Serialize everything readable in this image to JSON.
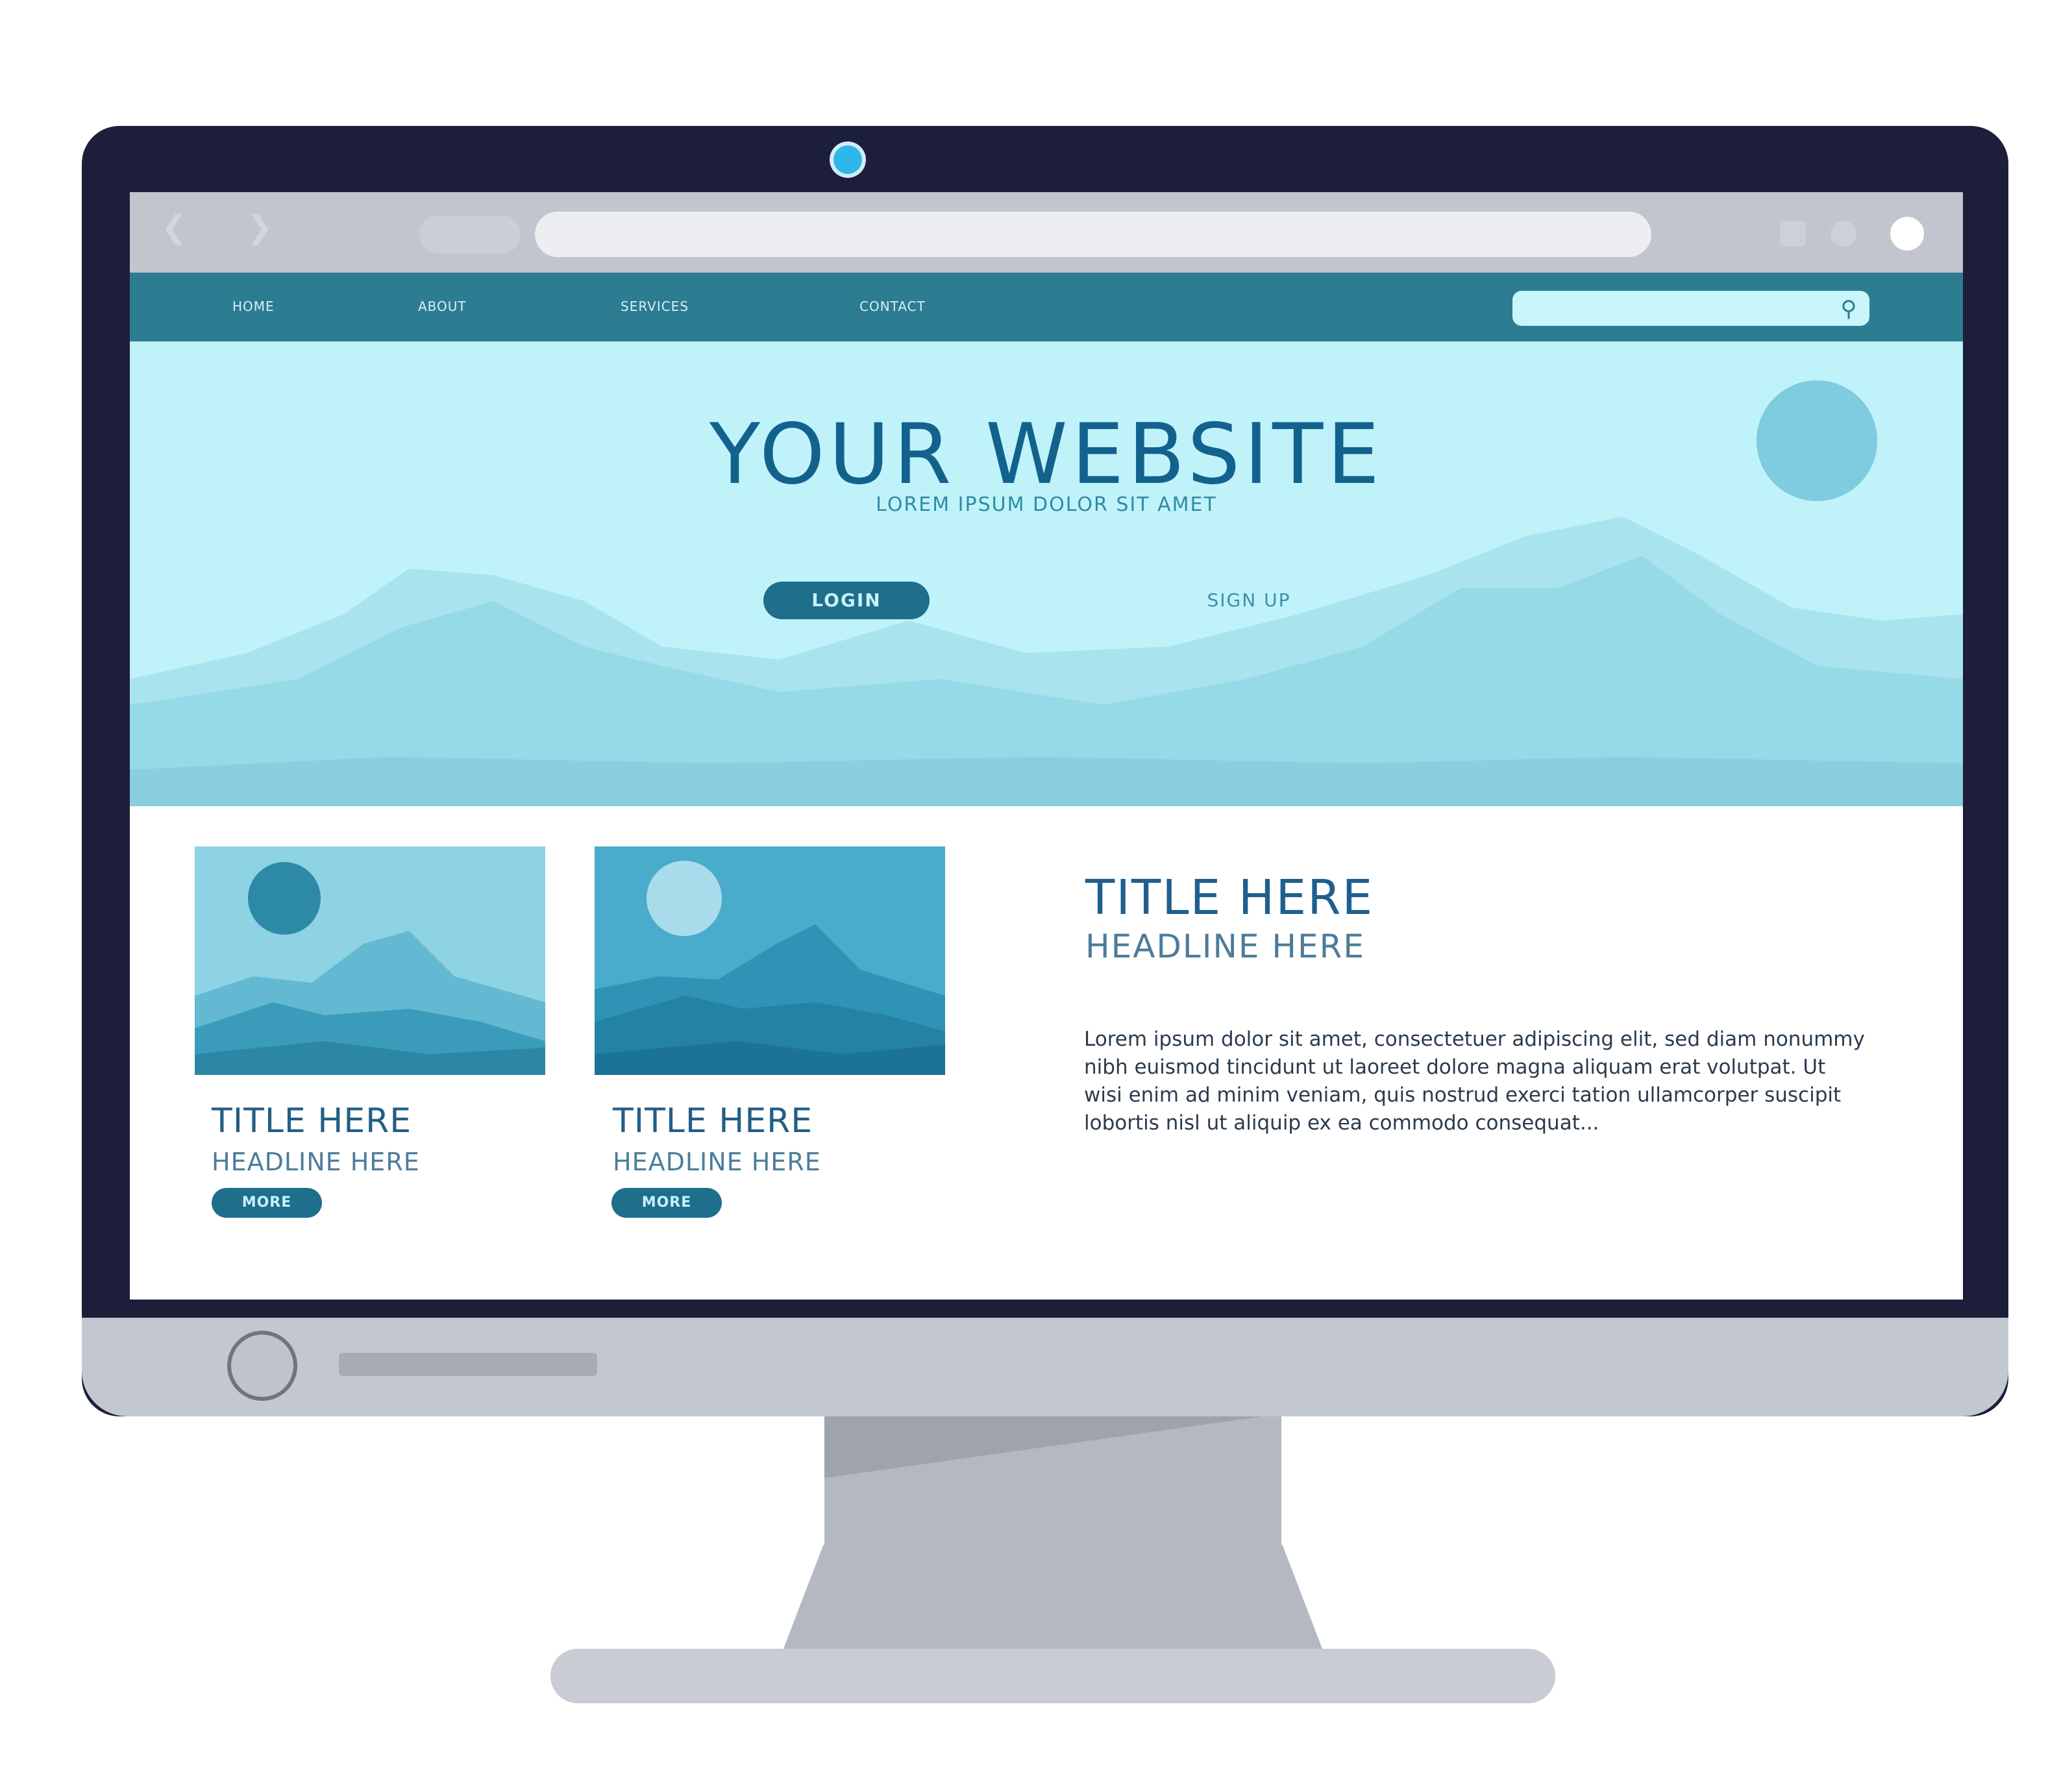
{
  "colors": {
    "bezel": "#1d1f3a",
    "nav_bar": "#2c7c92",
    "hero_background": "#bff3f9",
    "title_blue": "#13628e",
    "button": "#1e6e8c",
    "stand": "#b4b8c1"
  },
  "browser": {
    "back_icon": "chevron-left-icon",
    "forward_icon": "chevron-right-icon",
    "address": ""
  },
  "nav": {
    "links": [
      "HOME",
      "ABOUT",
      "SERVICES",
      "CONTACT"
    ],
    "search_placeholder": "",
    "search_icon": "magnifier-icon"
  },
  "hero": {
    "title": "YOUR WEBSITE",
    "subtitle": "LOREM IPSUM DOLOR SIT AMET",
    "login_label": "LOGIN",
    "signup_label": "SIGN UP"
  },
  "cards": [
    {
      "title": "TITLE HERE",
      "heading": "HEADLINE HERE",
      "button_label": "MORE"
    },
    {
      "title": "TITLE HERE",
      "heading": "HEADLINE HERE",
      "button_label": "MORE"
    }
  ],
  "article": {
    "title": "TITLE HERE",
    "heading": "HEADLINE HERE",
    "body": "Lorem ipsum dolor sit amet, consectetuer adipiscing elit, sed diam nonummy nibh euismod tincidunt ut laoreet dolore magna aliquam erat volutpat. Ut wisi enim ad minim veniam, quis nostrud exerci tation ullamcorper suscipit lobortis nisl ut aliquip ex ea commodo consequat..."
  }
}
